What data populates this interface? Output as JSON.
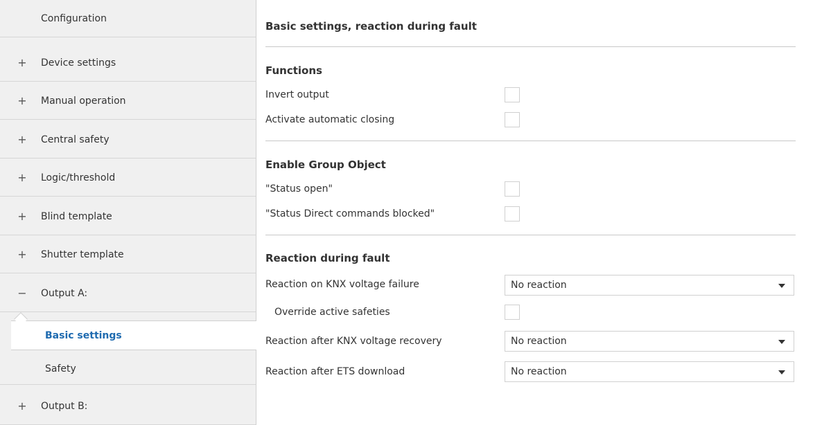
{
  "sidebar": {
    "items": [
      {
        "toggle": "",
        "label": "Configuration"
      },
      {
        "toggle": "+",
        "label": "Device settings"
      },
      {
        "toggle": "+",
        "label": "Manual operation"
      },
      {
        "toggle": "+",
        "label": "Central safety"
      },
      {
        "toggle": "+",
        "label": "Logic/threshold"
      },
      {
        "toggle": "+",
        "label": "Blind template"
      },
      {
        "toggle": "+",
        "label": "Shutter template"
      },
      {
        "toggle": "−",
        "label": "Output A:"
      },
      {
        "toggle": "",
        "label": "Basic settings"
      },
      {
        "toggle": "",
        "label": "Safety"
      },
      {
        "toggle": "+",
        "label": "Output B:"
      }
    ],
    "selected_color": "#1f6bb0"
  },
  "main": {
    "title": "Basic settings, reaction during fault",
    "functions": {
      "title": "Functions",
      "invert_output": "Invert output",
      "auto_closing": "Activate automatic closing"
    },
    "group_object": {
      "title": "Enable Group Object",
      "status_open": "\"Status open\"",
      "status_blocked": "\"Status Direct commands blocked\""
    },
    "fault": {
      "title": "Reaction during fault",
      "voltage_failure_label": "Reaction on KNX voltage failure",
      "voltage_failure_value": "No reaction",
      "override_label": "Override active safeties",
      "voltage_recovery_label": "Reaction after KNX voltage recovery",
      "voltage_recovery_value": "No reaction",
      "ets_download_label": "Reaction after ETS download",
      "ets_download_value": "No reaction"
    }
  }
}
